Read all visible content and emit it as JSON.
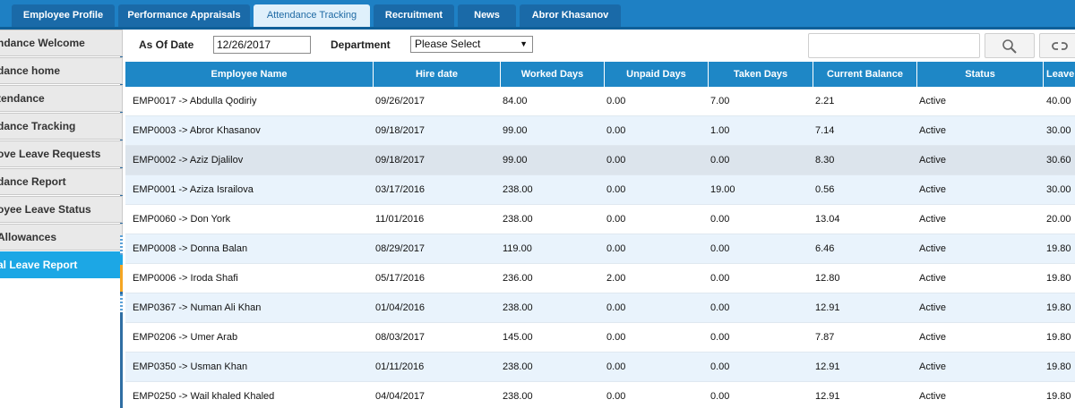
{
  "nav": {
    "tabs": [
      {
        "label": "Employee Profile",
        "active": false
      },
      {
        "label": "Performance Appraisals",
        "active": false
      },
      {
        "label": "Attendance Tracking",
        "active": true
      },
      {
        "label": "Recruitment",
        "active": false
      },
      {
        "label": "News",
        "active": false
      },
      {
        "label": "Abror Khasanov",
        "active": false
      }
    ]
  },
  "sidebar": {
    "items": [
      {
        "label": "ndance Welcome",
        "active": false
      },
      {
        "label": "dance home",
        "active": false
      },
      {
        "label": "tendance",
        "active": false
      },
      {
        "label": "dance Tracking",
        "active": false
      },
      {
        "label": "ove Leave Requests",
        "active": false
      },
      {
        "label": "dance Report",
        "active": false
      },
      {
        "label": "oyee Leave Status",
        "active": false
      },
      {
        "label": "Allowances",
        "active": false
      },
      {
        "label": "al Leave Report",
        "active": true
      }
    ]
  },
  "filters": {
    "as_of_label": "As Of Date",
    "as_of_value": "12/26/2017",
    "department_label": "Department",
    "department_value": "Please Select",
    "search_value": ""
  },
  "icons": {
    "search": "search-icon",
    "reset": "link-reset-icon",
    "dropdown": "chevron-down-icon"
  },
  "colors": {
    "header_blue": "#1e80c4",
    "accent_blue": "#1ca7e5",
    "grid_header": "#1e87c6",
    "row_alt": "#e9f3fc",
    "row_selected": "#dce4ec"
  },
  "table": {
    "columns": [
      "Employee Name",
      "Hire date",
      "Worked Days",
      "Unpaid Days",
      "Taken Days",
      "Current Balance",
      "Status",
      "Leave"
    ],
    "rows": [
      [
        "EMP0017 -> Abdulla Qodiriy",
        "09/26/2017",
        "84.00",
        "0.00",
        "7.00",
        "2.21",
        "Active",
        "40.00"
      ],
      [
        "EMP0003 -> Abror Khasanov",
        "09/18/2017",
        "99.00",
        "0.00",
        "1.00",
        "7.14",
        "Active",
        "30.00"
      ],
      [
        "EMP0002 -> Aziz Djalilov",
        "09/18/2017",
        "99.00",
        "0.00",
        "0.00",
        "8.30",
        "Active",
        "30.60"
      ],
      [
        "EMP0001 -> Aziza Israilova",
        "03/17/2016",
        "238.00",
        "0.00",
        "19.00",
        "0.56",
        "Active",
        "30.00"
      ],
      [
        "EMP0060 -> Don York",
        "11/01/2016",
        "238.00",
        "0.00",
        "0.00",
        "13.04",
        "Active",
        "20.00"
      ],
      [
        "EMP0008 -> Donna Balan",
        "08/29/2017",
        "119.00",
        "0.00",
        "0.00",
        "6.46",
        "Active",
        "19.80"
      ],
      [
        "EMP0006 -> Iroda Shafi",
        "05/17/2016",
        "236.00",
        "2.00",
        "0.00",
        "12.80",
        "Active",
        "19.80"
      ],
      [
        "EMP0367 -> Numan Ali Khan",
        "01/04/2016",
        "238.00",
        "0.00",
        "0.00",
        "12.91",
        "Active",
        "19.80"
      ],
      [
        "EMP0206 -> Umer Arab",
        "08/03/2017",
        "145.00",
        "0.00",
        "0.00",
        "7.87",
        "Active",
        "19.80"
      ],
      [
        "EMP0350 -> Usman Khan",
        "01/11/2016",
        "238.00",
        "0.00",
        "0.00",
        "12.91",
        "Active",
        "19.80"
      ],
      [
        "EMP0250 -> Wail khaled Khaled",
        "04/04/2017",
        "238.00",
        "0.00",
        "0.00",
        "12.91",
        "Active",
        "19.80"
      ]
    ],
    "selected_row": 2
  }
}
